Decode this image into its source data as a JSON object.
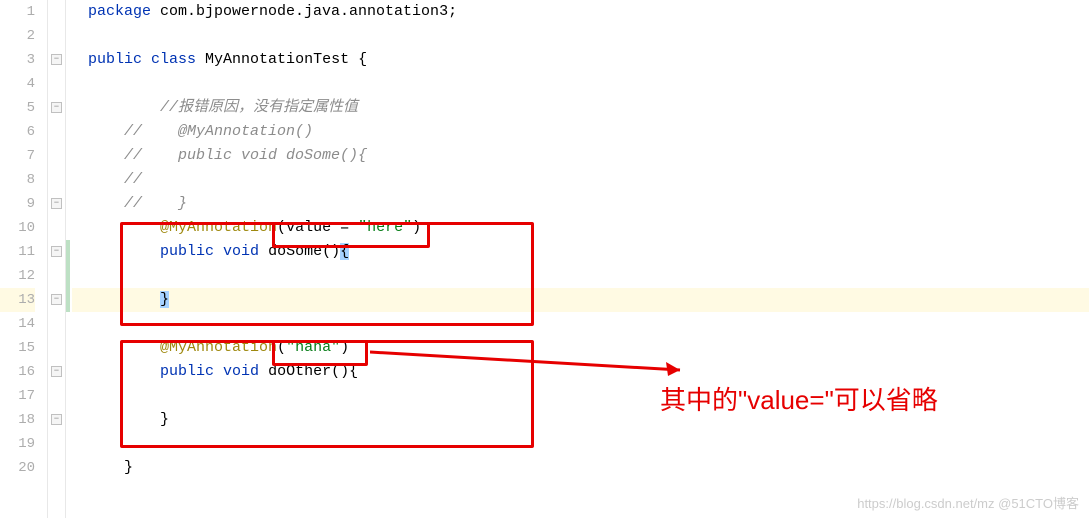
{
  "gutter": {
    "lines": [
      "1",
      "2",
      "3",
      "4",
      "5",
      "6",
      "7",
      "8",
      "9",
      "10",
      "11",
      "12",
      "13",
      "14",
      "15",
      "16",
      "17",
      "18",
      "19",
      "20"
    ]
  },
  "code": {
    "l1": {
      "kw1": "package",
      "pkg": " com.bjpowernode.java.annotation3;"
    },
    "l3": {
      "kw1": "public",
      "kw2": "class",
      "cls": " MyAnnotationTest ",
      "brace": "{"
    },
    "l5": {
      "indent": "        ",
      "comment": "//报错原因，没有指定属性值"
    },
    "l6": {
      "indent": "    ",
      "comment": "//    @MyAnnotation()"
    },
    "l7": {
      "indent": "    ",
      "comment": "//    public void doSome(){"
    },
    "l8": {
      "indent": "    ",
      "comment": "//"
    },
    "l9": {
      "indent": "    ",
      "comment": "//    }"
    },
    "l10": {
      "indent": "        ",
      "ann": "@MyAnnotation",
      "paren1": "(",
      "attr": "value = ",
      "str": "\"here\"",
      "paren2": ")"
    },
    "l11": {
      "indent": "        ",
      "kw1": "public",
      "kw2": "void",
      "method": " doSome()",
      "brace": "{"
    },
    "l13": {
      "indent": "        ",
      "brace": "}"
    },
    "l15": {
      "indent": "        ",
      "ann": "@MyAnnotation",
      "paren1": "(",
      "str": "\"haha\"",
      "paren2": ")"
    },
    "l16": {
      "indent": "        ",
      "kw1": "public",
      "kw2": "void",
      "method": " doOther()",
      "brace": "{"
    },
    "l18": {
      "indent": "        ",
      "brace": "}"
    },
    "l20": {
      "indent": "    ",
      "brace": "}"
    }
  },
  "annotation_text": "其中的\"value=\"可以省略",
  "watermark": "https://blog.csdn.net/mz @51CTO博客"
}
